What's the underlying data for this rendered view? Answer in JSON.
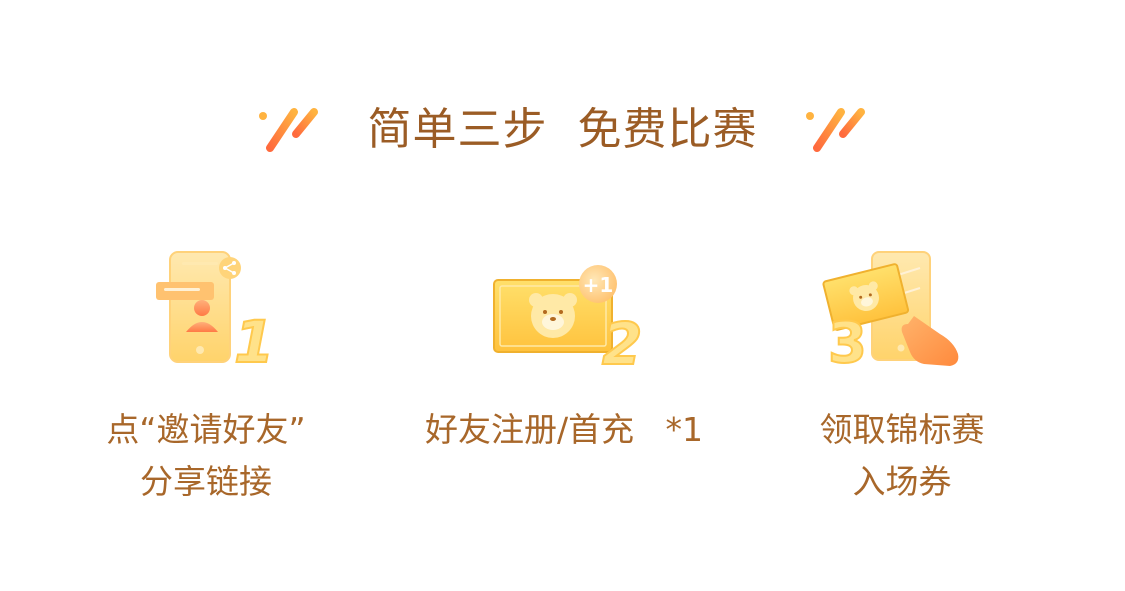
{
  "header": {
    "title": "简单三步  免费比赛",
    "decoration_colors": [
      "#ff7a45",
      "#ffb340"
    ]
  },
  "steps": [
    {
      "number": "1",
      "icon": "phone-share-icon",
      "line1": "点“邀请好友”",
      "line2": "分享链接"
    },
    {
      "number": "2",
      "icon": "ticket-plus-one-icon",
      "badge": "+1",
      "line1": "好友注册/首充   *1",
      "line2": ""
    },
    {
      "number": "3",
      "icon": "phone-ticket-hand-icon",
      "line1": "领取锦标赛",
      "line2": "入场券"
    }
  ],
  "colors": {
    "title": "#9b5c25",
    "caption": "#a8672a",
    "gold_light": "#ffe9a6",
    "gold": "#ffc94d",
    "gold_dark": "#f0b12e",
    "orange": "#ff8a3d"
  }
}
